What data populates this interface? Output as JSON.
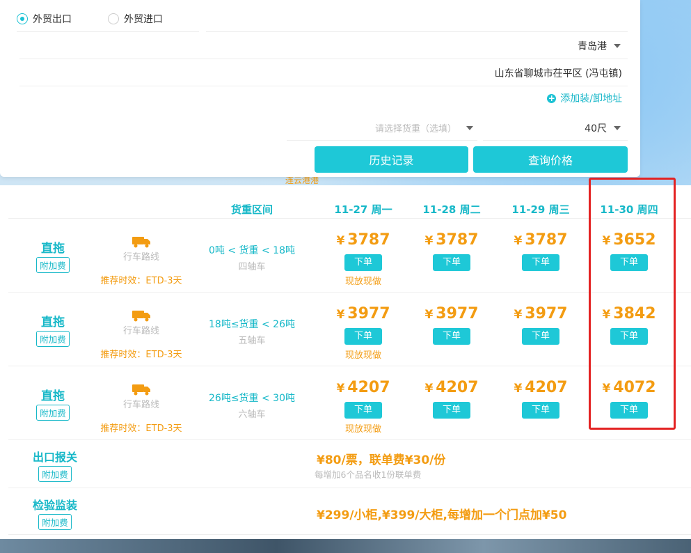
{
  "search": {
    "trade_options": [
      {
        "label": "外贸出口",
        "checked": true
      },
      {
        "label": "外贸进口",
        "checked": false
      }
    ],
    "port": "青岛港",
    "address": "山东省聊城市茌平区 (冯屯镇)",
    "add_address": "添加装/卸地址",
    "cargo_placeholder": "请选择货重（选填）",
    "container_size": "40尺",
    "history_button": "历史记录",
    "query_button": "查询价格"
  },
  "map_label": "连云港港",
  "table": {
    "weight_header": "货重区间",
    "dates": [
      "11-27 周一",
      "11-28 周二",
      "11-29 周三",
      "11-30 周四"
    ],
    "currency": "¥",
    "order_label": "下单",
    "rows": [
      {
        "type": "直拖",
        "surcharge": "附加费",
        "route_label": "行车路线",
        "eta": "推荐时效：ETD-3天",
        "weight_range": "0吨 < 货重 < 18吨",
        "axle": "四轴车",
        "prices": [
          "3787",
          "3787",
          "3787",
          "3652"
        ],
        "note": "现放现做"
      },
      {
        "type": "直拖",
        "surcharge": "附加费",
        "route_label": "行车路线",
        "eta": "推荐时效：ETD-3天",
        "weight_range": "18吨≤货重 < 26吨",
        "axle": "五轴车",
        "prices": [
          "3977",
          "3977",
          "3977",
          "3842"
        ],
        "note": "现放现做"
      },
      {
        "type": "直拖",
        "surcharge": "附加费",
        "route_label": "行车路线",
        "eta": "推荐时效：ETD-3天",
        "weight_range": "26吨≤货重 < 30吨",
        "axle": "六轴车",
        "prices": [
          "4207",
          "4207",
          "4207",
          "4072"
        ],
        "note": "现放现做"
      }
    ],
    "fees": [
      {
        "title": "出口报关",
        "surcharge": "附加费",
        "main": "¥80/票，联单费¥30/份",
        "sub": "每增加6个品名收1份联单费"
      },
      {
        "title": "检验监装",
        "surcharge": "附加费",
        "main": "¥299/小柜,¥399/大柜,每增加一个门点加¥50",
        "sub": ""
      }
    ]
  },
  "colors": {
    "accent": "#1ec8d7",
    "price": "#f39c12",
    "highlight": "#e32222"
  }
}
